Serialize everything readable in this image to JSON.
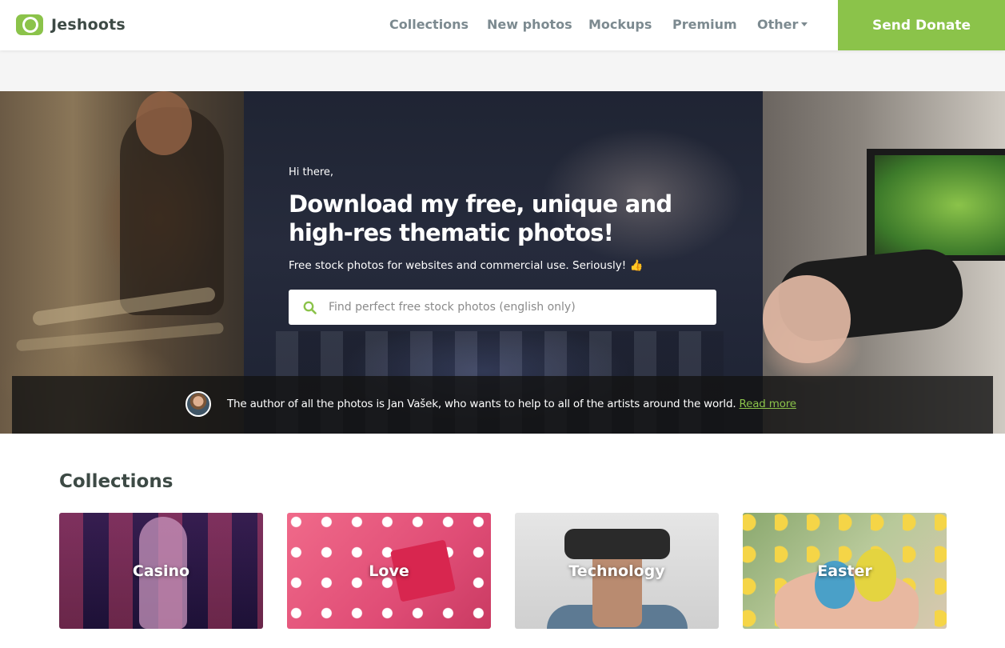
{
  "header": {
    "brand": "Jeshoots",
    "nav": [
      {
        "label": "Collections"
      },
      {
        "label": "New photos"
      },
      {
        "label": "Mockups"
      },
      {
        "label": "Premium"
      },
      {
        "label": "Other"
      }
    ],
    "donate_label": "Send Donate"
  },
  "hero": {
    "greeting": "Hi there,",
    "title": "Download my free, unique and high-res thematic photos!",
    "subtitle": "Free stock photos for websites and commercial use. Seriously! 👍",
    "search": {
      "placeholder": "Find perfect free stock photos (english only)",
      "value": ""
    },
    "author_text": "The author of all the photos is Jan Vašek, who wants to help to all of the artists around the world.",
    "author_link": "Read more"
  },
  "collections": {
    "title": "Collections",
    "items": [
      {
        "label": "Casino"
      },
      {
        "label": "Love"
      },
      {
        "label": "Technology"
      },
      {
        "label": "Easter"
      }
    ]
  },
  "colors": {
    "accent": "#8bc34a",
    "text_dark": "#3d4a45",
    "nav_text": "#7c8a90"
  }
}
